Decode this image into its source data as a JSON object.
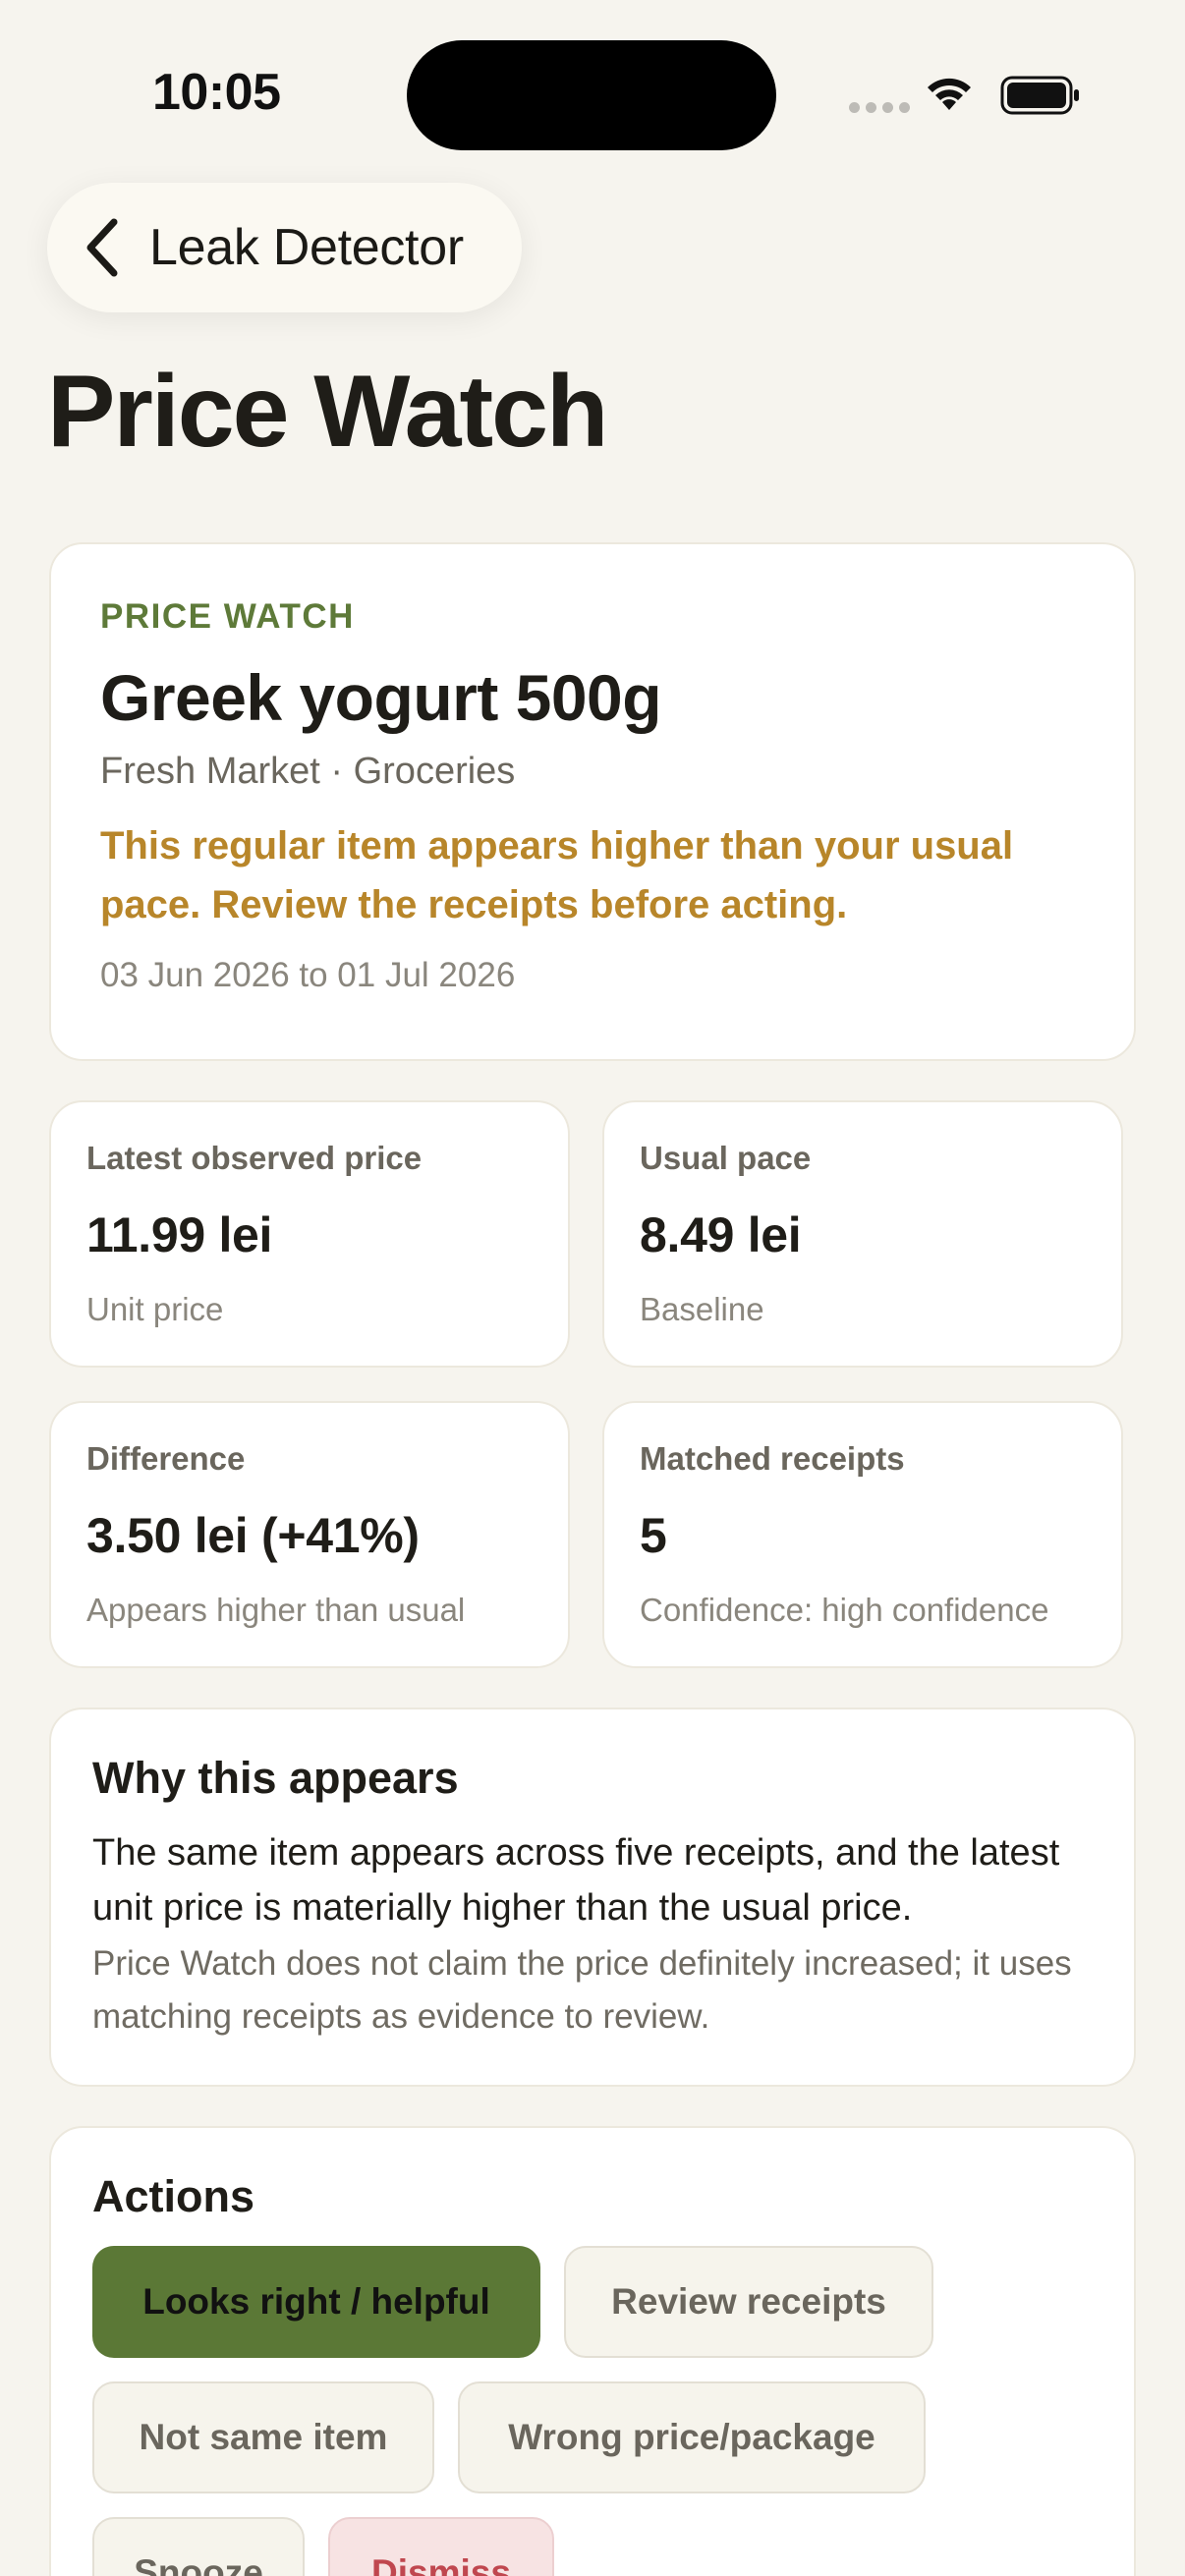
{
  "status_bar": {
    "time": "10:05",
    "icons": [
      "cellular-dots-icon",
      "wifi-icon",
      "battery-icon"
    ]
  },
  "nav": {
    "back_label": "Leak Detector",
    "back_icon": "chevron-left-icon"
  },
  "page_title": "Price Watch",
  "hero": {
    "eyebrow": "PRICE WATCH",
    "item_name": "Greek yogurt 500g",
    "merchant_category": "Fresh Market · Groceries",
    "warning": "This regular item appears higher than your usual pace. Review the receipts before acting.",
    "date_range": "03 Jun 2026 to 01 Jul 2026"
  },
  "stats": [
    {
      "label": "Latest observed price",
      "value": "11.99 lei",
      "caption": "Unit price"
    },
    {
      "label": "Usual pace",
      "value": "8.49 lei",
      "caption": "Baseline"
    },
    {
      "label": "Difference",
      "value": "3.50 lei (+41%)",
      "caption": "Appears higher than usual"
    },
    {
      "label": "Matched receipts",
      "value": "5",
      "caption": "Confidence: high confidence"
    }
  ],
  "why": {
    "heading": "Why this appears",
    "body": "The same item appears across five receipts, and the latest unit price is materially higher than the usual price.",
    "note": "Price Watch does not claim the price definitely increased; it uses matching receipts as evidence to review."
  },
  "actions": {
    "heading": "Actions",
    "buttons": [
      {
        "label": "Looks right / helpful"
      },
      {
        "label": "Review receipts"
      },
      {
        "label": "Not same item"
      },
      {
        "label": "Wrong price/package"
      },
      {
        "label": "Snooze"
      },
      {
        "label": "Dismiss"
      }
    ]
  },
  "colors": {
    "background": "#f6f4ee",
    "accent_green": "#5b7836",
    "eyebrow_green": "#5e7a39",
    "warning_amber": "#b8862a",
    "danger_red": "#c0474f"
  }
}
